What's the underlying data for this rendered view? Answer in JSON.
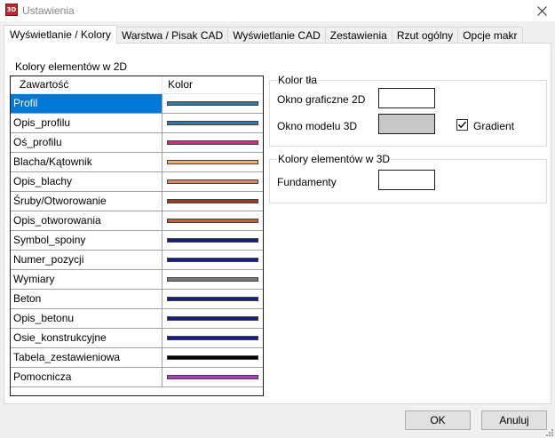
{
  "window": {
    "title": "Ustawienia",
    "app_icon_text": "3D",
    "app_icon_color": "#c0282d"
  },
  "tabs": [
    {
      "label": "Wyświetlanie / Kolory",
      "active": true
    },
    {
      "label": "Warstwa / Pisak CAD",
      "active": false
    },
    {
      "label": "Wyświetlanie CAD",
      "active": false
    },
    {
      "label": "Zestawienia",
      "active": false
    },
    {
      "label": "Rzut ogólny",
      "active": false
    },
    {
      "label": "Opcje makr",
      "active": false
    }
  ],
  "colors_2d": {
    "caption": "Kolory elementów w 2D",
    "header_name": "Zawartość",
    "header_color": "Kolor",
    "selection_color": "#0078d7",
    "rows": [
      {
        "name": "Profil",
        "color": "#1e7fc0",
        "selected": true
      },
      {
        "name": "Opis_profilu",
        "color": "#1e7fc0",
        "selected": false
      },
      {
        "name": "Oś_profilu",
        "color": "#f01e82",
        "selected": false
      },
      {
        "name": "Blacha/Kątownik",
        "color": "#f5b82e",
        "selected": false
      },
      {
        "name": "Opis_blachy",
        "color": "#f5824b",
        "selected": false
      },
      {
        "name": "Śruby/Otworowanie",
        "color": "#c02828",
        "selected": false
      },
      {
        "name": "Opis_otworowania",
        "color": "#e0503c",
        "selected": false
      },
      {
        "name": "Symbol_spoiny",
        "color": "#1414b4",
        "selected": false
      },
      {
        "name": "Numer_pozycji",
        "color": "#1414b4",
        "selected": false
      },
      {
        "name": "Wymiary",
        "color": "#787878",
        "selected": false
      },
      {
        "name": "Beton",
        "color": "#1414b4",
        "selected": false
      },
      {
        "name": "Opis_betonu",
        "color": "#1414b4",
        "selected": false
      },
      {
        "name": "Osie_konstrukcyjne",
        "color": "#1414b4",
        "selected": false
      },
      {
        "name": "Tabela_zestawieniowa",
        "color": "#000000",
        "selected": false
      },
      {
        "name": "Pomocnicza",
        "color": "#d22dc8",
        "selected": false
      }
    ]
  },
  "background_color": {
    "legend": "Kolor tła",
    "graphics_2d_label": "Okno graficzne 2D",
    "graphics_2d_color": "#ffffff",
    "model_3d_label": "Okno modelu 3D",
    "model_3d_color": "#c8c8c8",
    "gradient_label": "Gradient",
    "gradient_checked": true
  },
  "colors_3d": {
    "legend": "Kolory elementów w 3D",
    "foundations_label": "Fundamenty",
    "foundations_color": "#ffffff"
  },
  "buttons": {
    "ok": "OK",
    "cancel": "Anuluj"
  }
}
